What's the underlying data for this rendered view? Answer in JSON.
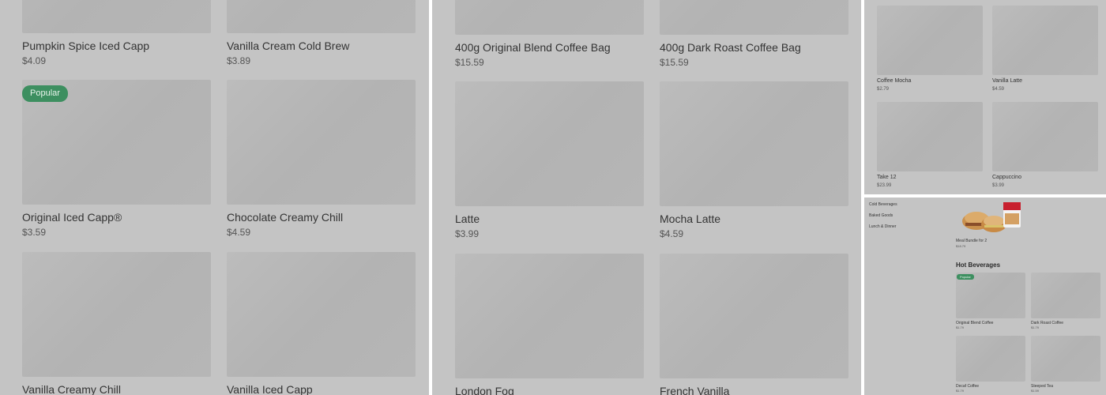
{
  "panel1": {
    "items": [
      {
        "name": "Pumpkin Spice Iced Capp",
        "price": "$4.09"
      },
      {
        "name": "Vanilla Cream Cold Brew",
        "price": "$3.89"
      },
      {
        "name": "Original Iced Capp®",
        "price": "$3.59",
        "badge": "Popular"
      },
      {
        "name": "Chocolate Creamy Chill",
        "price": "$4.59"
      },
      {
        "name": "Vanilla Creamy Chill",
        "price": ""
      },
      {
        "name": "Vanilla Iced Capp",
        "price": ""
      }
    ]
  },
  "panel2": {
    "items": [
      {
        "name": "400g Original Blend Coffee Bag",
        "price": "$15.59"
      },
      {
        "name": "400g Dark Roast Coffee Bag",
        "price": "$15.59"
      },
      {
        "name": "Latte",
        "price": "$3.99"
      },
      {
        "name": "Mocha Latte",
        "price": "$4.59"
      },
      {
        "name": "London Fog",
        "price": ""
      },
      {
        "name": "French Vanilla",
        "price": ""
      }
    ]
  },
  "panel3": {
    "items": [
      {
        "name": "Coffee Mocha",
        "price": "$2.79"
      },
      {
        "name": "Vanilla Latte",
        "price": "$4.59"
      },
      {
        "name": "Take 12",
        "price": "$23.99"
      },
      {
        "name": "Cappuccino",
        "price": "$3.99"
      }
    ]
  },
  "panel4": {
    "sidebar": [
      "Cold Beverages",
      "Baked Goods",
      "Lunch & Dinner"
    ],
    "bundle": {
      "name": "Meal Bundle for 2",
      "price": "$18.79"
    },
    "section_title": "Hot Beverages",
    "badge": "Popular",
    "items": [
      {
        "name": "Original Blend Coffee",
        "price": "$1.79"
      },
      {
        "name": "Dark Roast Coffee",
        "price": "$1.79"
      },
      {
        "name": "Decaf Coffee",
        "price": "$1.79"
      },
      {
        "name": "Steeped Tea",
        "price": "$1.59"
      }
    ]
  },
  "colors": {
    "overlay": "#c4c4c4",
    "placeholder": "#b8b8b8",
    "badge": "#3d8f60",
    "divider": "#ffffff"
  }
}
